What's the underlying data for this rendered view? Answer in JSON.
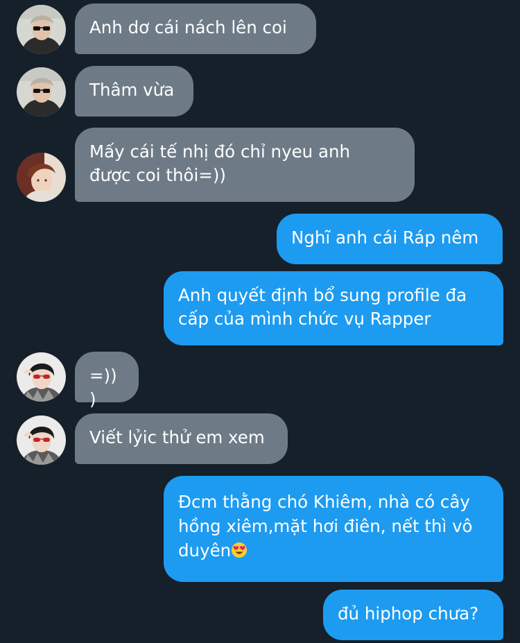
{
  "conversation": {
    "messages": [
      {
        "from": "contact",
        "text": "Anh dơ cái nách lên coi"
      },
      {
        "from": "contact",
        "text": "Thâm vừa"
      },
      {
        "from": "contact",
        "text": "Mấy cái tế nhị đó chỉ nyeu anh\nđược coi thôi=))"
      },
      {
        "from": "me",
        "text": "Nghĩ anh cái Ráp nêm"
      },
      {
        "from": "me",
        "text": "Anh quyết định bổ sung profile đa\ncấp của mình chức vụ Rapper"
      },
      {
        "from": "contact",
        "text": "=)))"
      },
      {
        "from": "contact",
        "text": "Viết lỷic thử em xem"
      },
      {
        "from": "me",
        "text": "Đcm thằng chó Khiêm, nhà có cây\nhồng xiêm,mặt hơi điên, nết thì vô\nduyên",
        "emoji": "heart-eyes-emoji"
      },
      {
        "from": "me",
        "text": "đủ hiphop chưa?"
      }
    ]
  },
  "colors": {
    "background": "#15202b",
    "incoming_bubble": "#6e7b87",
    "outgoing_bubble": "#1d9bf0",
    "text": "#ffffff"
  }
}
